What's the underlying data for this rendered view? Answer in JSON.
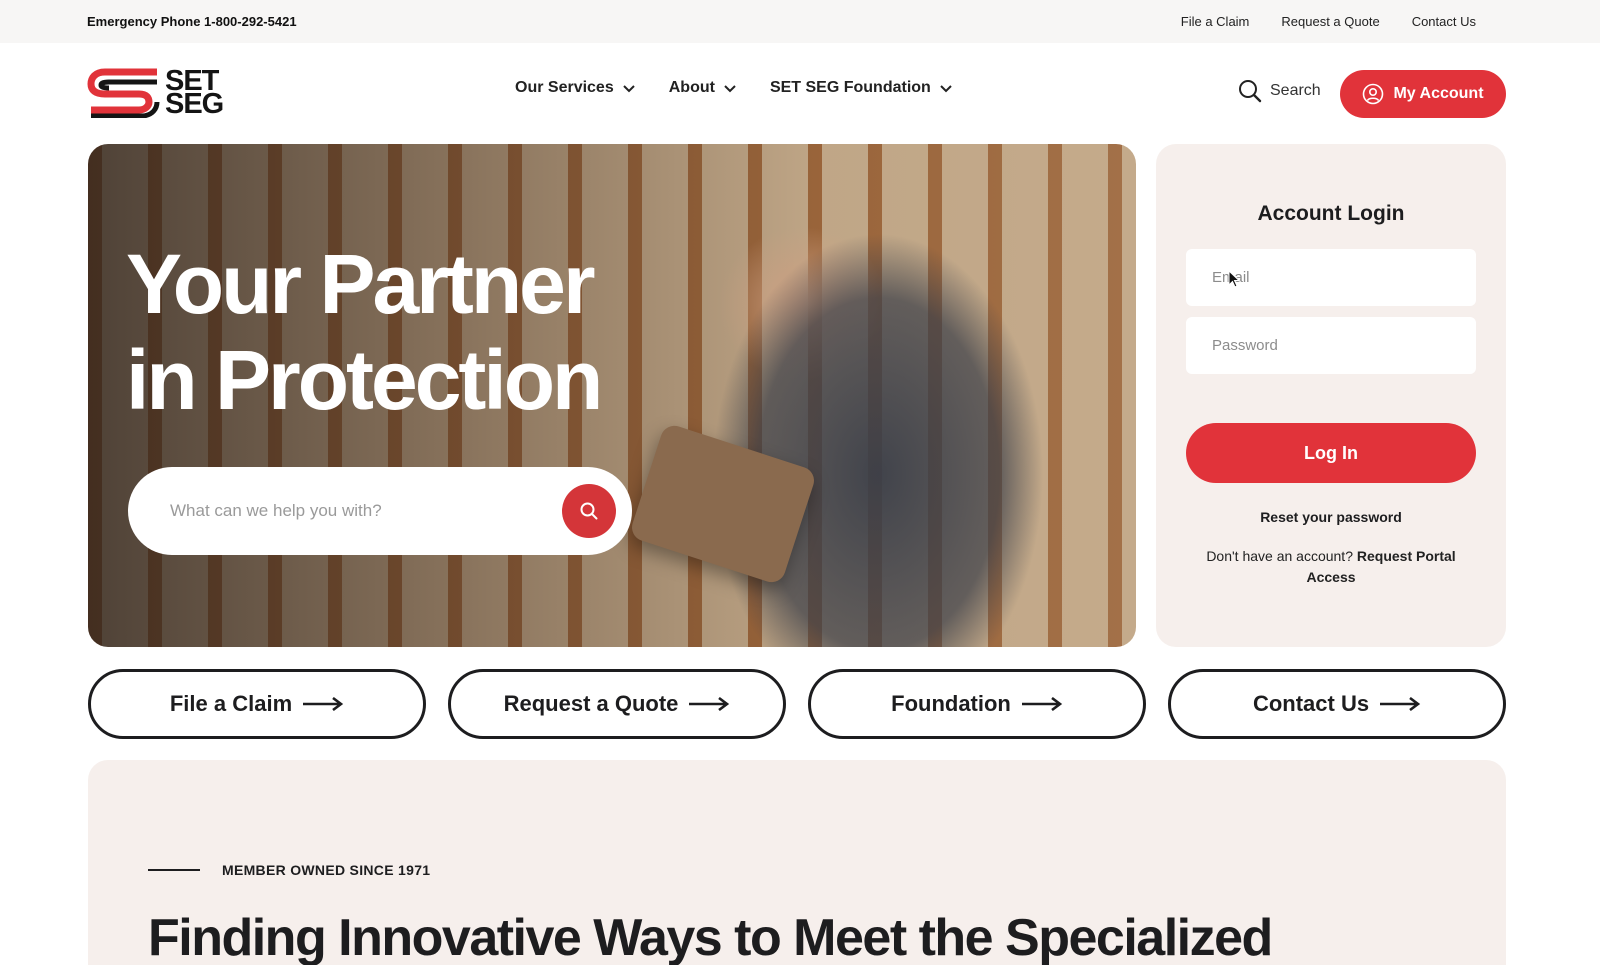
{
  "topbar": {
    "emergency": "Emergency Phone 1-800-292-5421",
    "links": [
      "File a Claim",
      "Request a Quote",
      "Contact Us"
    ]
  },
  "header": {
    "logo_line1": "SET",
    "logo_line2": "SEG",
    "nav": [
      "Our Services",
      "About",
      "SET SEG Foundation"
    ],
    "search_label": "Search",
    "account_label": "My Account"
  },
  "hero": {
    "headline_line1": "Your Partner",
    "headline_line2": "in Protection",
    "search_placeholder": "What can we help you with?"
  },
  "login": {
    "title": "Account Login",
    "email_placeholder": "Email",
    "password_placeholder": "Password",
    "button_label": "Log In",
    "reset_label": "Reset your password",
    "signup_text": "Don't have an account?",
    "signup_link": "Request Portal Access"
  },
  "quick_links": [
    "File a Claim",
    "Request a Quote",
    "Foundation",
    "Contact Us"
  ],
  "about": {
    "eyebrow": "MEMBER OWNED SINCE 1971",
    "heading": "Finding Innovative Ways to Meet the Specialized"
  },
  "colors": {
    "accent": "#e1333a",
    "panel": "#f6efec",
    "topbar": "#f7f6f5"
  }
}
